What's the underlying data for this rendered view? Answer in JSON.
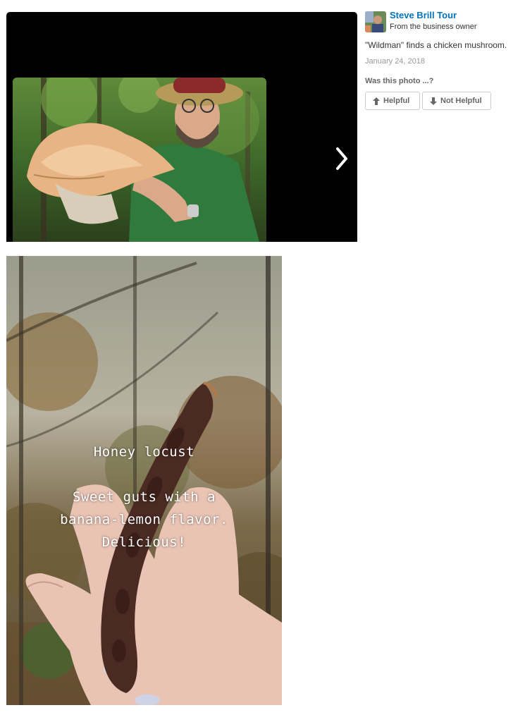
{
  "side_panel": {
    "owner_name": "Steve Brill Tour",
    "owner_role": "From the business owner",
    "caption": "\"Wildman\" finds a chicken mushroom.",
    "date": "January 24, 2018",
    "question": "Was this photo ...?",
    "helpful_label": "Helpful",
    "not_helpful_label": "Not Helpful"
  },
  "second_photo": {
    "overlay_lines": [
      "Honey locust",
      "Sweet guts with a",
      "banana-lemon flavor.",
      "Delicious!"
    ]
  },
  "colors": {
    "link_blue": "#0073bb",
    "viewer_bg": "#000000",
    "muted_text": "#999999"
  },
  "icons": [
    "chevron-right-icon",
    "arrow-up-icon",
    "arrow-down-icon"
  ]
}
